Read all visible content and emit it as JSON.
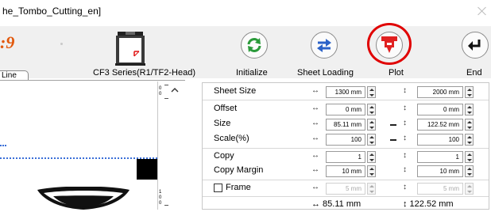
{
  "window": {
    "title": "he_Tombo_Cutting_en]"
  },
  "logo_fragment": ":9",
  "machine": {
    "label": "CF3 Series(R1/TF2-Head)"
  },
  "tab": {
    "label": "Line"
  },
  "toolbar": {
    "initialize_label": "Initialize",
    "sheet_loading_label": "Sheet Loading",
    "plot_label": "Plot",
    "end_label": "End"
  },
  "ruler": {
    "top_label": "0",
    "top_label_2": "0",
    "bottom_1": "1",
    "bottom_2": "0",
    "bottom_3": "0"
  },
  "settings": {
    "arrow_h": "↔",
    "arrow_v": "↕",
    "sheet_size": {
      "label": "Sheet Size",
      "x": "1300 mm",
      "y": "2000 mm"
    },
    "offset": {
      "label": "Offset",
      "x": "0 mm",
      "y": "0 mm"
    },
    "size": {
      "label": "Size",
      "x": "85.11 mm",
      "y": "122.52 mm"
    },
    "scale": {
      "label": "Scale(%)",
      "x": "100",
      "y": "100"
    },
    "copy": {
      "label": "Copy",
      "x": "1",
      "y": "1"
    },
    "copy_margin": {
      "label": "Copy Margin",
      "x": "10 mm",
      "y": "10 mm"
    },
    "frame": {
      "label": "Frame",
      "checked": false,
      "x": "5 mm",
      "y": "5 mm"
    },
    "summary": {
      "x": "↔ 85.11 mm",
      "y": "↕ 122.52 mm"
    }
  },
  "colors": {
    "accent_ring": "#e00000",
    "plot_icon": "#e02020",
    "initialize_icon": "#2a9a3a",
    "sheet_loading_icon": "#2b62c8"
  }
}
